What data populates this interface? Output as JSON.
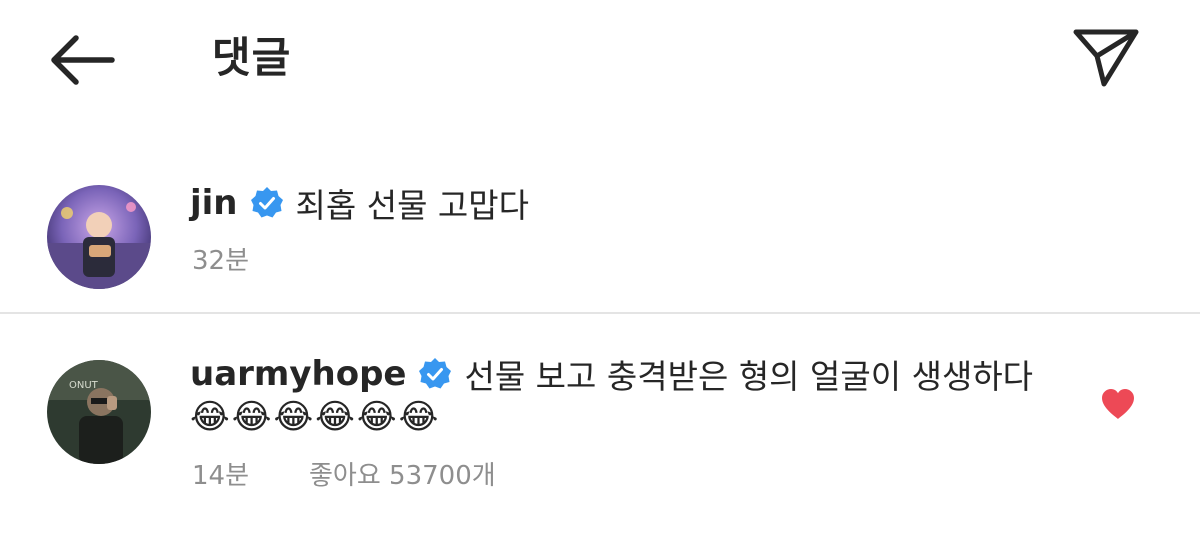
{
  "header": {
    "title": "댓글",
    "back_icon": "arrow-left-icon",
    "share_icon": "paper-plane-icon"
  },
  "comments": [
    {
      "username": "jin",
      "verified": true,
      "text": "죄홉 선물 고맙다",
      "time": "32분"
    },
    {
      "username": "uarmyhope",
      "verified": true,
      "text": "선물 보고 충격받은 형의 얼굴이 생생하다",
      "emoji_line": "😂😂😂😂😂😂",
      "time": "14분",
      "likes": "좋아요 53700개",
      "liked": true
    }
  ],
  "colors": {
    "verified_badge": "#3897f0",
    "heart": "#ed4956",
    "meta_text": "#8e8e8e",
    "divider": "#e4e4e4"
  }
}
